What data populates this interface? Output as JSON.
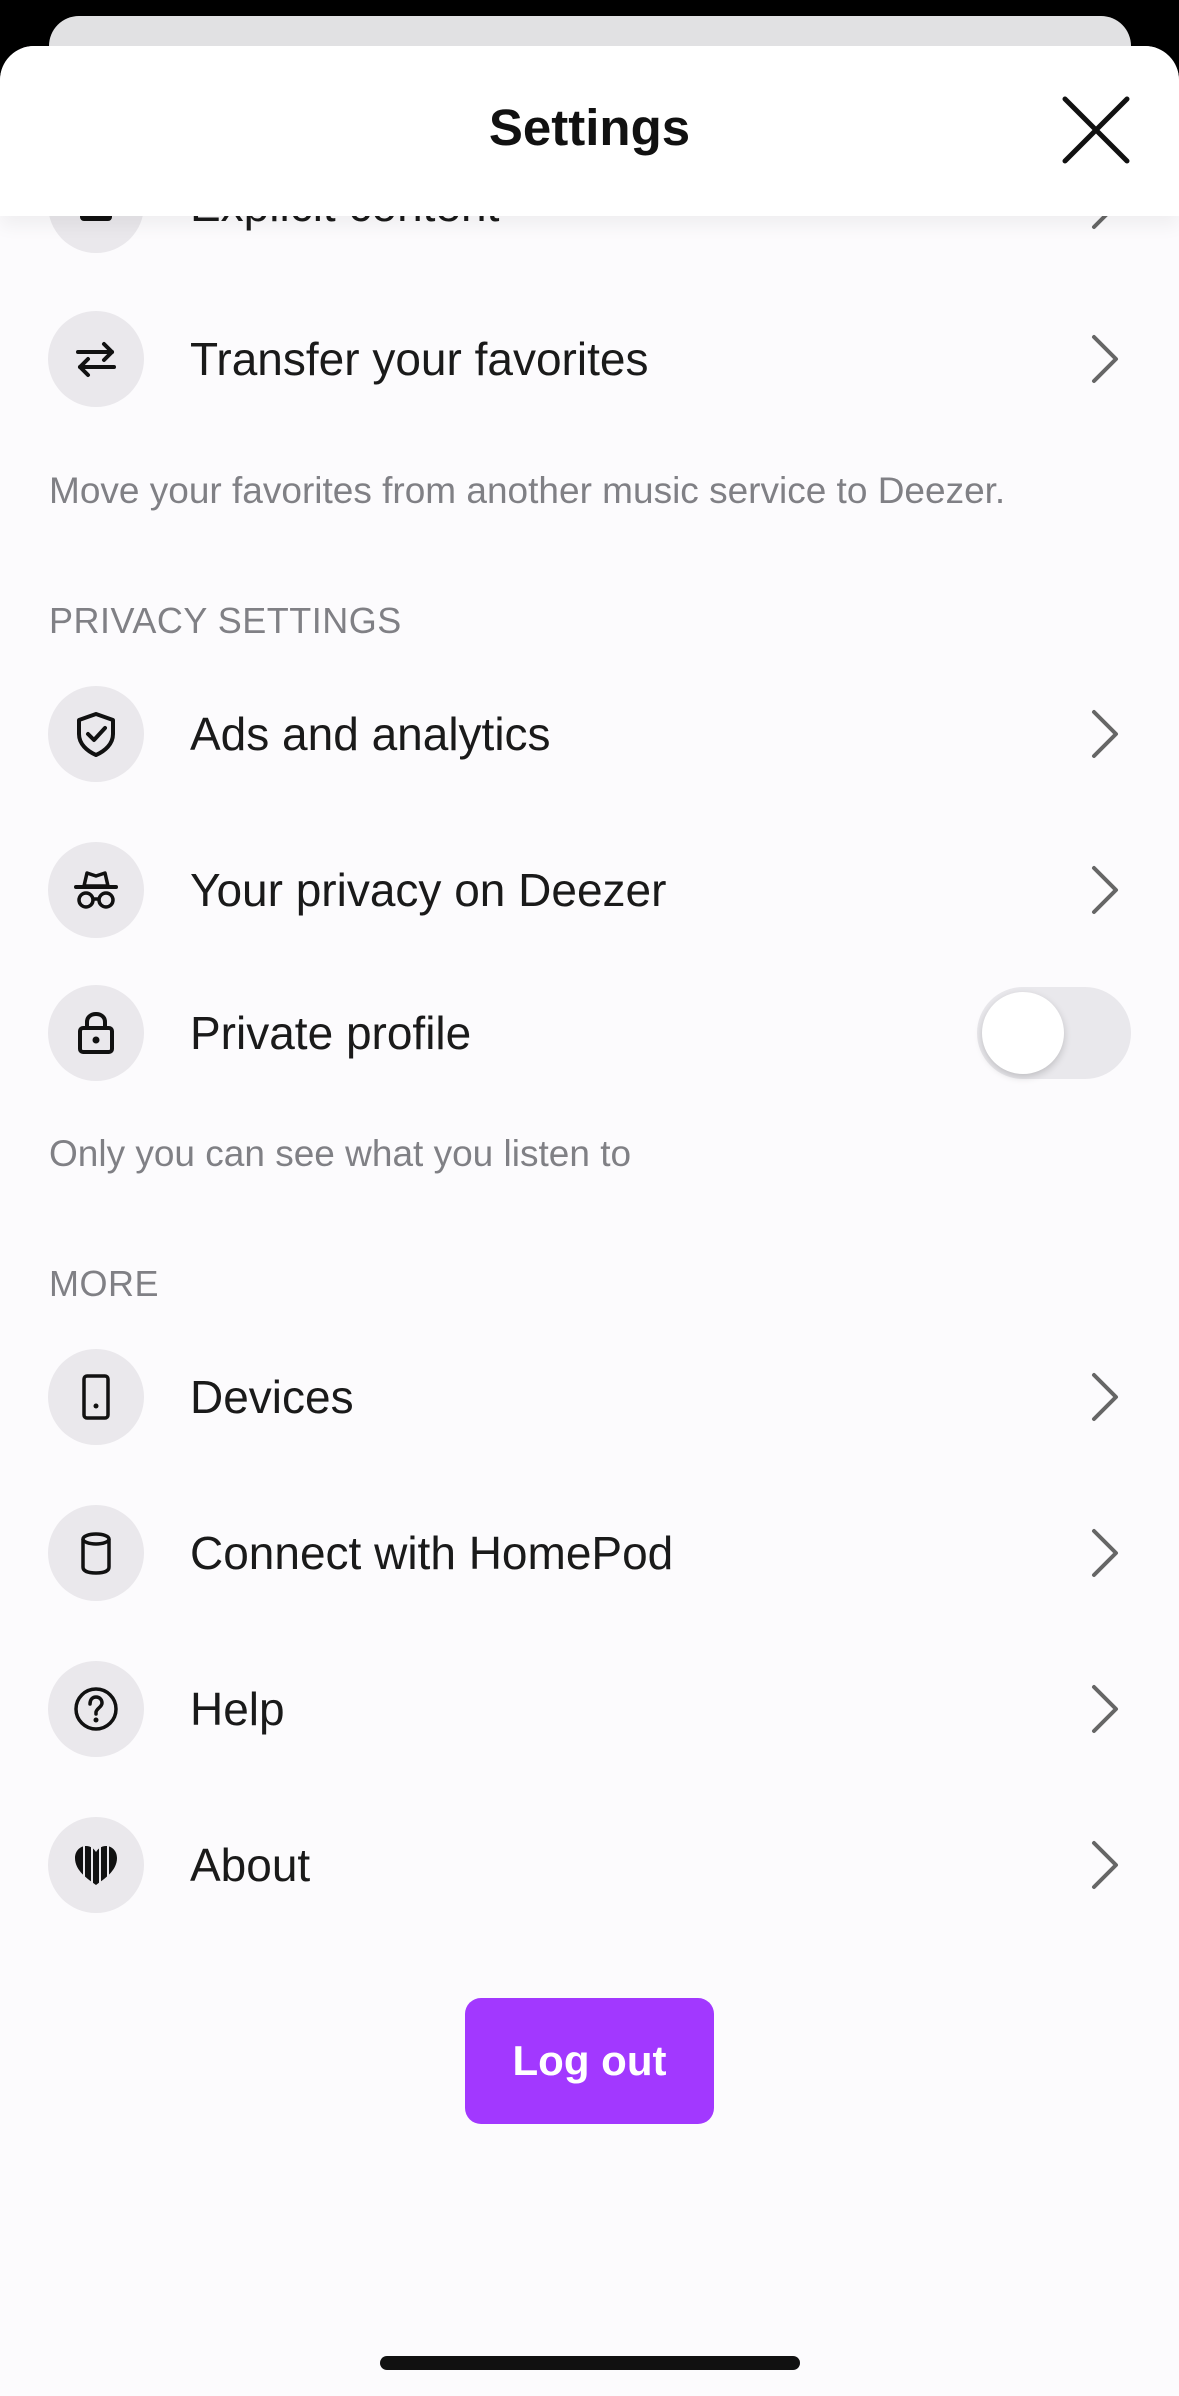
{
  "header": {
    "title": "Settings"
  },
  "rows": {
    "explicit": {
      "label": "Explicit content"
    },
    "transfer": {
      "label": "Transfer your favorites",
      "caption": "Move your favorites from another music service to Deezer."
    },
    "ads": {
      "label": "Ads and analytics"
    },
    "privacy": {
      "label": "Your privacy on Deezer"
    },
    "private_profile": {
      "label": "Private profile",
      "caption": "Only you can see what you listen to",
      "enabled": false
    },
    "devices": {
      "label": "Devices"
    },
    "homepod": {
      "label": "Connect with HomePod"
    },
    "help": {
      "label": "Help"
    },
    "about": {
      "label": "About"
    }
  },
  "sections": {
    "privacy": "PRIVACY SETTINGS",
    "more": "MORE"
  },
  "logout": {
    "label": "Log out"
  },
  "colors": {
    "accent": "#a238ff",
    "icon_bg": "#eae8ec",
    "caption": "#808085"
  },
  "icons": {
    "explicit": "explicit-icon",
    "transfer": "transfer-arrows-icon",
    "ads": "shield-check-icon",
    "privacy": "incognito-icon",
    "private_profile": "lock-icon",
    "devices": "phone-icon",
    "homepod": "homepod-icon",
    "help": "question-circle-icon",
    "about": "deezer-heart-icon",
    "close": "close-icon",
    "chevron": "chevron-right-icon"
  }
}
